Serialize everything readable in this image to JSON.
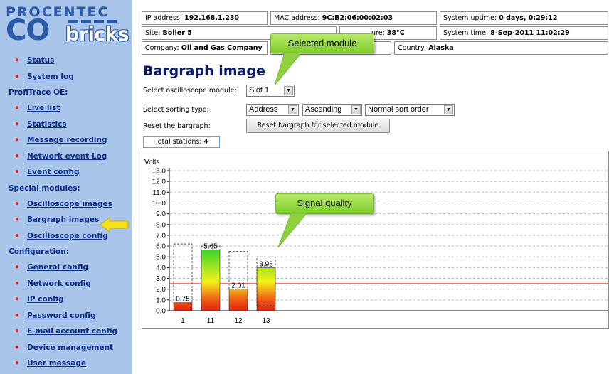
{
  "logo": {
    "word_top": "PROCENTEC",
    "word_co": "CO",
    "word_bricks": "bricks"
  },
  "sidebar": {
    "sections": [
      {
        "heading": null,
        "items": [
          "Status",
          "System log"
        ]
      },
      {
        "heading": "ProfiTrace OE:",
        "items": [
          "Live list",
          "Statistics",
          "Message recording",
          "Network event Log",
          "Event config"
        ]
      },
      {
        "heading": "Special modules:",
        "items": [
          "Oscilloscope images",
          "Bargraph images",
          "Oscilloscope config"
        ]
      },
      {
        "heading": "Configuration:",
        "items": [
          "General config",
          "Network config",
          "IP config",
          "Password config",
          "E-mail account config",
          "Device management",
          "User message"
        ]
      }
    ],
    "highlighted_item": "Bargraph images",
    "arrow_color": "#f5e020"
  },
  "info": {
    "ip_label": "IP address:",
    "ip": "192.168.1.230",
    "mac_label": "MAC address:",
    "mac": "9C:B2:06:00:02:03",
    "uptime_label": "System uptime:",
    "uptime": "0 days, 0:29:12",
    "site_label": "Site:",
    "site": "Boiler 5",
    "temp_label_partial": "ure:",
    "temp": "38°C",
    "time_label": "System time:",
    "time": "8-Sep-2011 11:02:29",
    "company_label": "Company:",
    "company": "Oil and Gas Company",
    "country_label": "Country:",
    "country": "Alaska"
  },
  "callouts": {
    "selected_module": "Selected module",
    "signal_quality": "Signal quality",
    "color": "#9ddc4a"
  },
  "page_title": "Bargraph image",
  "form": {
    "osc_label": "Select oscilloscope module:",
    "osc_value": "Slot 1",
    "sort_label": "Select sorting type:",
    "sort_by": "Address",
    "sort_dir": "Ascending",
    "sort_order": "Normal sort order",
    "reset_label": "Reset the bargraph:",
    "reset_button": "Reset bargraph for selected module",
    "total_stations": "Total stations: 4"
  },
  "chart_data": {
    "type": "bar",
    "ylabel": "Volts",
    "ylim": [
      0,
      13
    ],
    "yticks": [
      "0.0",
      "1.0",
      "2.0",
      "3.0",
      "4.0",
      "5.0",
      "6.0",
      "7.0",
      "8.0",
      "9.0",
      "10.0",
      "11.0",
      "12.0",
      "13.0"
    ],
    "categories": [
      "1",
      "11",
      "12",
      "13"
    ],
    "values": [
      0.75,
      5.65,
      2.01,
      3.98
    ],
    "value_labels": [
      "0.75",
      "5.65",
      "2.01",
      "3.98"
    ],
    "max_values": [
      6.2,
      6.0,
      5.5,
      5.0
    ],
    "min_values": [
      0.65,
      5.65,
      2.01,
      0.45
    ],
    "threshold": 2.5,
    "threshold_color": "#e02020",
    "bar_gradient": [
      "#26d02a",
      "#f3f21a",
      "#f06014",
      "#e02010"
    ],
    "grid": true
  }
}
